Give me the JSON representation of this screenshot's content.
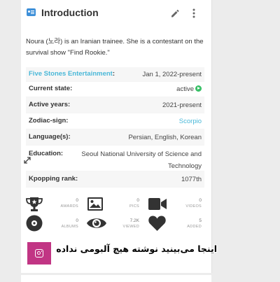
{
  "header": {
    "title": "Introduction"
  },
  "intro_text": "Noura (노라) is an Iranian trainee. She is a contestant on the survival show \"Find Rookie.\"",
  "info": {
    "agency": {
      "label": "Five Stones Entertainment",
      "suffix": ":",
      "value": "Jan 1, 2022-present"
    },
    "current_state": {
      "label": "Current state:",
      "value": "active"
    },
    "active_years": {
      "label": "Active years:",
      "value": "2021-present"
    },
    "zodiac": {
      "label": "Zodiac-sign:",
      "value": "Scorpio"
    },
    "languages": {
      "label": "Language(s):",
      "value": "Persian, English, Korean"
    },
    "education": {
      "label": "Education:",
      "value_line1": "Seoul National University of Science and",
      "value_line2": "Technology"
    },
    "rank": {
      "label": "Kpopping rank:",
      "value": "1077th"
    }
  },
  "stats": {
    "awards": {
      "count": "0",
      "label": "AWARDS"
    },
    "pics": {
      "count": "0",
      "label": "PICS"
    },
    "videos": {
      "count": "0",
      "label": "VIDEOS"
    },
    "albums": {
      "count": "0",
      "label": "ALBUMS"
    },
    "viewed": {
      "count": "7.2K",
      "label": "VIEWED"
    },
    "added": {
      "count": "5",
      "label": "ADDED"
    }
  },
  "overlay_text": "اینجا می‌بینید نوشته هیچ آلبومی نداده",
  "colors": {
    "accent": "#4ab8d8",
    "active": "#38c066",
    "instagram": "#c13584",
    "header_icon": "#3d8fd8"
  },
  "icons": [
    "id-card-icon",
    "pencil-icon",
    "more-vertical-icon",
    "expand-icon",
    "trophy-icon",
    "image-icon",
    "video-camera-icon",
    "disc-icon",
    "eye-icon",
    "heart-icon",
    "instagram-icon"
  ]
}
